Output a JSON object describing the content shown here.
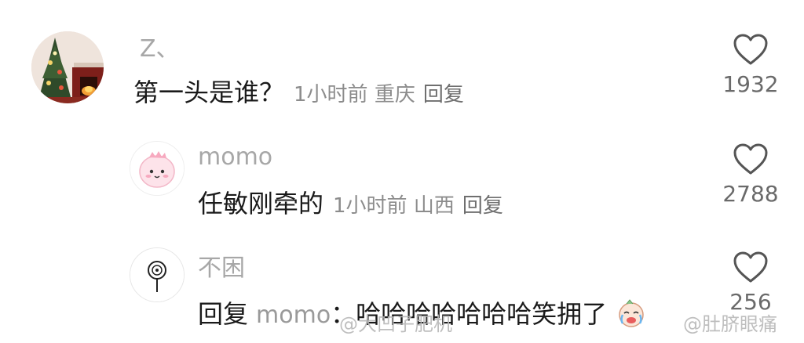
{
  "comments": [
    {
      "username": "Z、",
      "content": "第一头是谁？",
      "time": "1小时前",
      "location": "重庆",
      "reply_label": "回复",
      "likes": "1932",
      "avatar_icon": "christmas-tree-avatar"
    },
    {
      "username": "momo",
      "content": "任敏刚牵的",
      "time": "1小时前",
      "location": "山西",
      "reply_label": "回复",
      "likes": "2788",
      "avatar_icon": "pink-dinosaur-avatar"
    },
    {
      "username": "不困",
      "reply_prefix": "回复",
      "reply_target": "momo",
      "content": "：哈哈哈哈哈哈哈笑拥了",
      "likes": "256",
      "avatar_icon": "lollipop-avatar",
      "trailing_emoji": "crying-laughing-emoji"
    }
  ],
  "watermarks": {
    "left": "@大凹子肥机",
    "right": "@肚脐眼痛"
  },
  "colors": {
    "username": "#a7a7a7",
    "content": "#1a1a1a",
    "meta": "#8c8c8c",
    "heart_outline": "#555555"
  }
}
